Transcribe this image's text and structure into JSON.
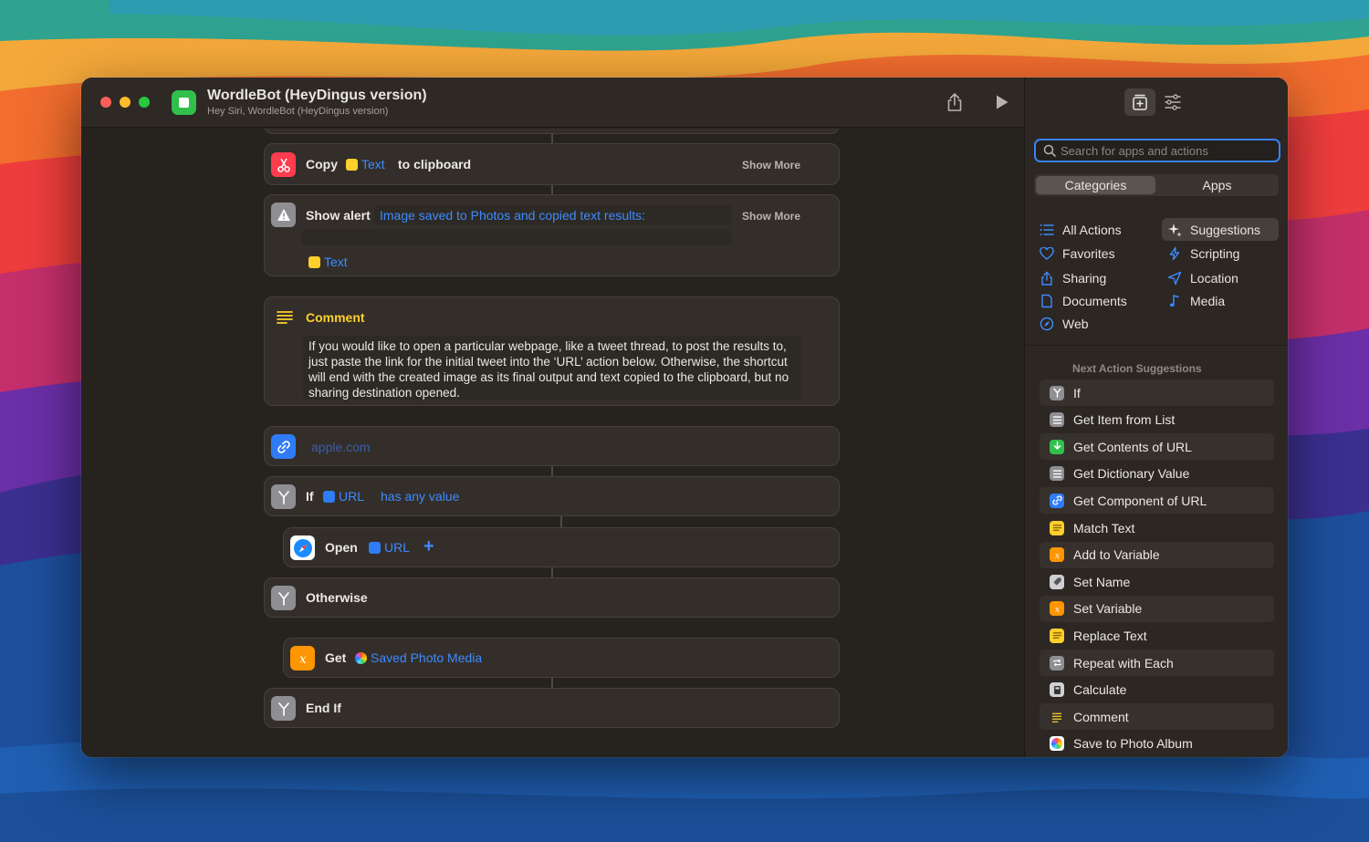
{
  "window": {
    "title": "WordleBot (HeyDingus version)",
    "subtitle": "Hey Siri, WordleBot (HeyDingus version)"
  },
  "actions": {
    "copy": {
      "verb": "Copy",
      "token": "Text",
      "suffix": "to clipboard",
      "show_more": "Show More"
    },
    "alert": {
      "verb": "Show alert",
      "message": "Image saved to Photos and copied text results:",
      "token": "Text",
      "show_more": "Show More"
    },
    "comment": {
      "label": "Comment",
      "text": "If you would like to open a particular webpage, like a tweet thread, to post the results to, just paste the link for the initial tweet into the ‘URL’ action below. Otherwise, the shortcut will end with the created image as its final output and text copied to the clipboard, but no sharing destination opened."
    },
    "url": {
      "placeholder": "apple.com"
    },
    "if": {
      "verb": "If",
      "token": "URL",
      "condition": "has any value"
    },
    "open": {
      "verb": "Open",
      "token": "URL",
      "add": "+"
    },
    "otherwise": {
      "verb": "Otherwise"
    },
    "get": {
      "verb": "Get",
      "token": "Saved Photo Media"
    },
    "endif": {
      "verb": "End If"
    }
  },
  "sidebar": {
    "search_placeholder": "Search for apps and actions",
    "segments": [
      "Categories",
      "Apps"
    ],
    "active_segment": "Categories",
    "categories_left": [
      "All Actions",
      "Favorites",
      "Sharing",
      "Documents",
      "Web"
    ],
    "categories_right": [
      "Suggestions",
      "Scripting",
      "Location",
      "Media"
    ],
    "active_category": "Suggestions",
    "suggestions_header": "Next Action Suggestions",
    "suggestions": [
      {
        "label": "If",
        "icon": "if-branch-icon",
        "color": "#8e8e93"
      },
      {
        "label": "Get Item from List",
        "icon": "list-icon",
        "color": "#8e8e93"
      },
      {
        "label": "Get Contents of URL",
        "icon": "download-icon",
        "color": "#30c04b"
      },
      {
        "label": "Get Dictionary Value",
        "icon": "dictionary-icon",
        "color": "#8e8e93"
      },
      {
        "label": "Get Component of URL",
        "icon": "link-icon",
        "color": "#2f7cf6"
      },
      {
        "label": "Match Text",
        "icon": "text-icon",
        "color": "#ffcf2e"
      },
      {
        "label": "Add to Variable",
        "icon": "variable-icon",
        "color": "#ff9500"
      },
      {
        "label": "Set Name",
        "icon": "tag-icon",
        "color": "#d0d0d4"
      },
      {
        "label": "Set Variable",
        "icon": "variable-icon",
        "color": "#ff9500"
      },
      {
        "label": "Replace Text",
        "icon": "text-icon",
        "color": "#ffcf2e"
      },
      {
        "label": "Repeat with Each",
        "icon": "repeat-icon",
        "color": "#8e8e93"
      },
      {
        "label": "Calculate",
        "icon": "calculator-icon",
        "color": "#d0d0d4"
      },
      {
        "label": "Comment",
        "icon": "comment-icon",
        "color": "#ffcf2e"
      },
      {
        "label": "Save to Photo Album",
        "icon": "photos-icon",
        "color": "#ffffff"
      }
    ]
  },
  "colors": {
    "accent": "#3a82f6",
    "token_blue": "#3d8bff",
    "comment_yellow": "#ffcf2e",
    "copy_red": "#ff3b4e"
  }
}
